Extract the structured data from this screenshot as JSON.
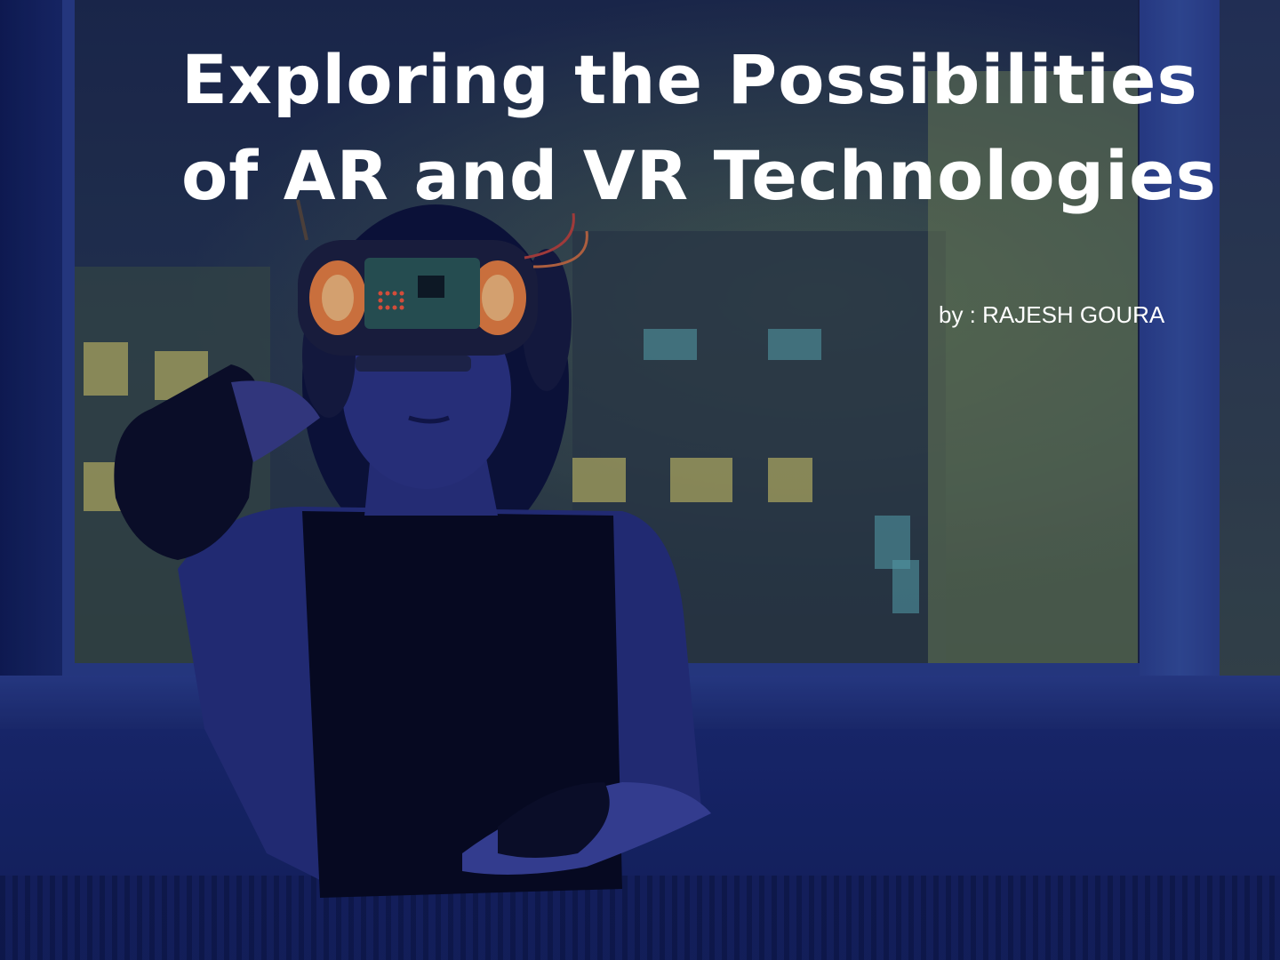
{
  "slide": {
    "title_line_1": "Exploring the Possibilities",
    "title_line_2": "of AR and VR Technologies",
    "byline": "by : RAJESH GOURA"
  },
  "colors": {
    "background_tone": "#14205a",
    "title_text": "#ffffff",
    "headset_glow": "#ff8a3d"
  },
  "image": {
    "subject_icon": "vr-headset-person-photo"
  }
}
